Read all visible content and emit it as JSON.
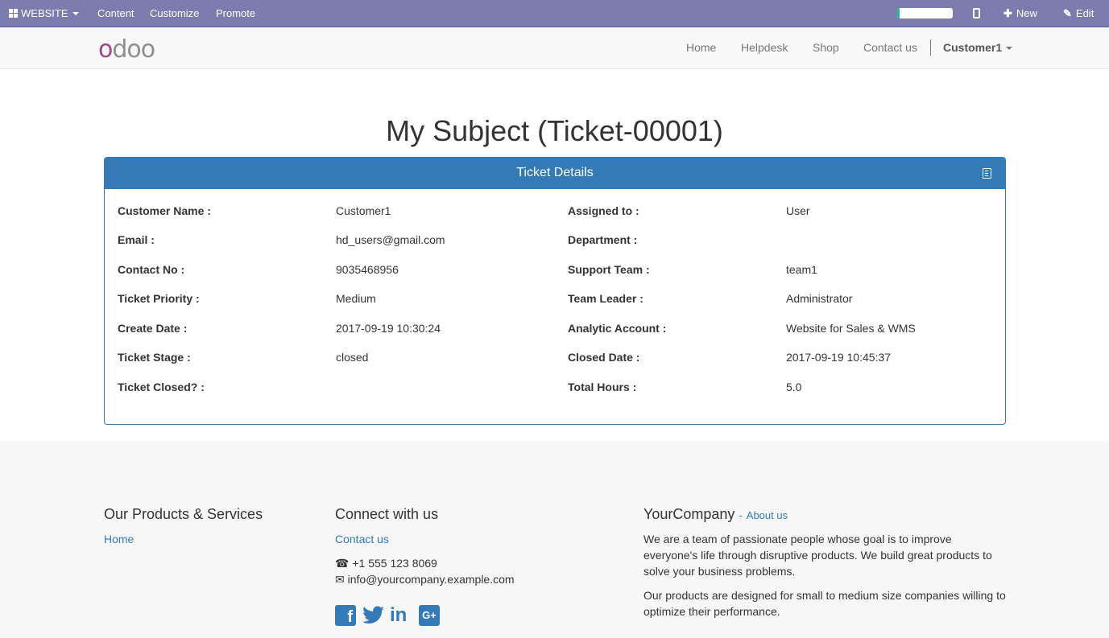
{
  "adminbar": {
    "website_label": "WEBSITE",
    "content_label": "Content",
    "customize_label": "Customize",
    "promote_label": "Promote",
    "progress_fraction": 0.05,
    "new_label": "New",
    "edit_label": "Edit"
  },
  "navbar": {
    "logo_first": "o",
    "logo_rest": "doo",
    "links": [
      "Home",
      "Helpdesk",
      "Shop",
      "Contact us"
    ],
    "user_label": "Customer1"
  },
  "ticket": {
    "title": "My Subject (Ticket-00001)",
    "panel_title": "Ticket Details",
    "left": [
      {
        "label": "Customer Name :",
        "value": "Customer1"
      },
      {
        "label": "Email :",
        "value": "hd_users@gmail.com"
      },
      {
        "label": "Contact No :",
        "value": "9035468956"
      },
      {
        "label": "Ticket Priority :",
        "value": "Medium"
      },
      {
        "label": "Create Date :",
        "value": "2017-09-19 10:30:24"
      },
      {
        "label": "Ticket Stage :",
        "value": "closed"
      },
      {
        "label": "Ticket Closed? :",
        "value": ""
      }
    ],
    "right": [
      {
        "label": "Assigned to :",
        "value": "User"
      },
      {
        "label": "Department :",
        "value": ""
      },
      {
        "label": "Support Team :",
        "value": "team1"
      },
      {
        "label": "Team Leader :",
        "value": "Administrator"
      },
      {
        "label": "Analytic Account :",
        "value": "Website for Sales & WMS"
      },
      {
        "label": "Closed Date :",
        "value": "2017-09-19 10:45:37"
      },
      {
        "label": "Total Hours :",
        "value": "5.0"
      }
    ]
  },
  "footer": {
    "products_title": "Our Products & Services",
    "products_links": [
      "Home"
    ],
    "connect_title": "Connect with us",
    "connect_link": "Contact us",
    "phone": "+1 555 123 8069",
    "email": "info@yourcompany.example.com",
    "company_title": "YourCompany",
    "about_link": "About us",
    "about_sep": "-",
    "para1": "We are a team of passionate people whose goal is to improve everyone's life through disruptive products. We build great products to solve your business problems.",
    "para2": "Our products are designed for small to medium size companies willing to optimize their performance."
  },
  "icons": {
    "social": [
      "facebook-icon",
      "twitter-icon",
      "linkedin-icon",
      "google-plus-icon"
    ]
  },
  "colors": {
    "adminbar": "#7c7bad",
    "primary": "#337ab7",
    "progress": "#21b799",
    "logo_accent": "#a24689"
  }
}
